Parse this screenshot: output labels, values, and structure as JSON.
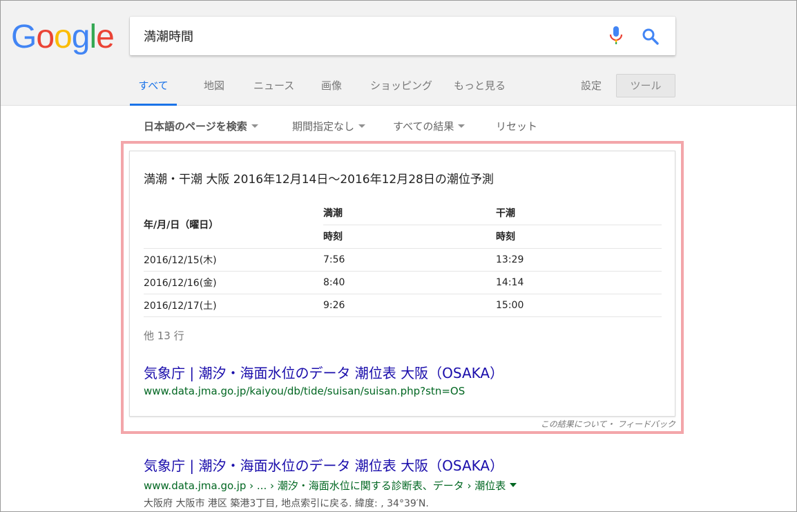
{
  "logo": {
    "letters": [
      "G",
      "o",
      "o",
      "g",
      "l",
      "e"
    ],
    "colors": [
      "#4285F4",
      "#EA4335",
      "#FBBC05",
      "#4285F4",
      "#34A853",
      "#EA4335"
    ]
  },
  "search": {
    "value": "満潮時間"
  },
  "tabs": [
    {
      "label": "すべて",
      "active": true
    },
    {
      "label": "地図"
    },
    {
      "label": "ニュース"
    },
    {
      "label": "画像"
    },
    {
      "label": "ショッピング"
    },
    {
      "label": "もっと見る"
    }
  ],
  "settings_label": "設定",
  "tools_label": "ツール",
  "filters": {
    "language": "日本語のページを検索",
    "period": "期間指定なし",
    "results": "すべての結果",
    "reset": "リセット"
  },
  "snippet": {
    "title": "満潮・干潮 大阪 2016年12月14日～2016年12月28日の潮位予測",
    "table": {
      "col_date": "年/月/日（曜日）",
      "col_high": "満潮",
      "col_low": "干潮",
      "sub_high": "時刻",
      "sub_low": "時刻",
      "rows": [
        {
          "date": "2016/12/15(木)",
          "high": "7:56",
          "low": "13:29"
        },
        {
          "date": "2016/12/16(金)",
          "high": "8:40",
          "low": "14:14"
        },
        {
          "date": "2016/12/17(土)",
          "high": "9:26",
          "low": "15:00"
        }
      ]
    },
    "more_rows": "他 13 行",
    "link_title": "気象庁 | 潮汐・海面水位のデータ 潮位表 大阪（OSAKA）",
    "link_url": "www.data.jma.go.jp/kaiyou/db/tide/suisan/suisan.php?stn=OS",
    "feedback": "この結果について・ フィードバック"
  },
  "result2": {
    "title": "気象庁 | 潮汐・海面水位のデータ 潮位表 大阪（OSAKA）",
    "url": "www.data.jma.go.jp › ... › 潮汐・海面水位に関する診断表、データ › 潮位表",
    "snippet": "大阪府 大阪市 港区 築港3丁目, 地点索引に戻る. 緯度: , 34°39′N."
  },
  "colors": {
    "accent_blue": "#1a73e8",
    "link": "#1a0dab",
    "url_green": "#006621",
    "highlight_border": "#f3a6aa"
  }
}
